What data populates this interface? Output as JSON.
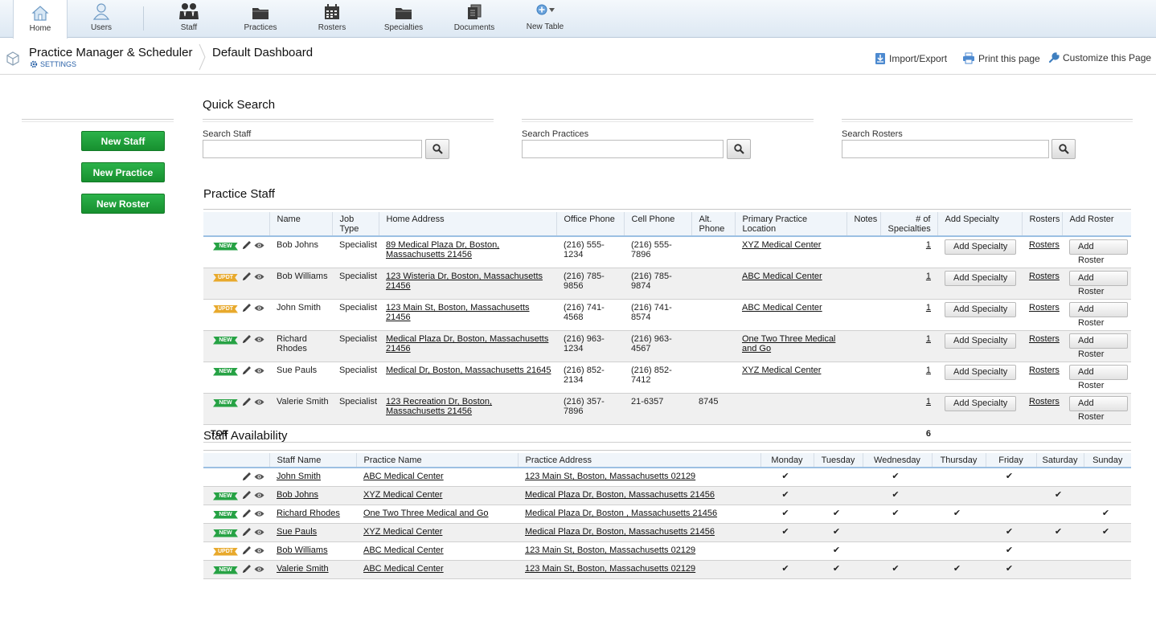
{
  "nav": {
    "items": [
      {
        "label": "Home",
        "icon": "home-icon"
      },
      {
        "label": "Users",
        "icon": "user-icon"
      },
      {
        "label": "Staff",
        "icon": "staff-icon"
      },
      {
        "label": "Practices",
        "icon": "folder-icon"
      },
      {
        "label": "Rosters",
        "icon": "calendar-icon"
      },
      {
        "label": "Specialties",
        "icon": "folder-icon"
      },
      {
        "label": "Documents",
        "icon": "documents-icon"
      },
      {
        "label": "New Table",
        "icon": "add-table-icon"
      }
    ]
  },
  "header": {
    "app_title": "Practice Manager & Scheduler",
    "settings_label": "SETTINGS",
    "page_title": "Default Dashboard",
    "import_export": "Import/Export",
    "print": "Print this page",
    "customize": "Customize this Page"
  },
  "sidebar": {
    "new_staff": "New Staff",
    "new_practice": "New Practice",
    "new_roster": "New Roster"
  },
  "quick_search": {
    "title": "Quick Search",
    "staff_label": "Search Staff",
    "practices_label": "Search Practices",
    "rosters_label": "Search Rosters"
  },
  "practice_staff": {
    "title": "Practice Staff",
    "columns": {
      "name": "Name",
      "job_type": "Job Type",
      "home_address": "Home Address",
      "office_phone": "Office Phone",
      "cell_phone": "Cell Phone",
      "alt_phone": "Alt. Phone",
      "primary_location": "Primary Practice Location",
      "notes": "Notes",
      "num_specialties": "# of Specialties",
      "add_specialty": "Add Specialty",
      "rosters": "Rosters",
      "add_roster": "Add Roster"
    },
    "rows": [
      {
        "tag": "NEW",
        "name": "Bob Johns",
        "job_type": "Specialist",
        "address": "89 Medical Plaza Dr, Boston, Massachusetts 21456",
        "office": "(216) 555-1234",
        "cell": "(216) 555-7896",
        "alt": "",
        "location": "XYZ Medical Center",
        "notes": "",
        "specialties": "1",
        "add_specialty": "Add Specialty",
        "rosters": "Rosters",
        "add_roster": "Add Roster"
      },
      {
        "tag": "UPDT",
        "name": "Bob Williams",
        "job_type": "Specialist",
        "address": "123 Wisteria Dr, Boston, Massachusetts 21456",
        "office": "(216) 785-9856",
        "cell": "(216) 785-9874",
        "alt": "",
        "location": "ABC Medical Center",
        "notes": "",
        "specialties": "1",
        "add_specialty": "Add Specialty",
        "rosters": "Rosters",
        "add_roster": "Add Roster"
      },
      {
        "tag": "UPDT",
        "name": "John Smith",
        "job_type": "Specialist",
        "address": "123 Main St, Boston, Massachusetts 21456",
        "office": "(216) 741-4568",
        "cell": "(216) 741-8574",
        "alt": "",
        "location": "ABC Medical Center",
        "notes": "",
        "specialties": "1",
        "add_specialty": "Add Specialty",
        "rosters": "Rosters",
        "add_roster": "Add Roster"
      },
      {
        "tag": "NEW",
        "name": "Richard Rhodes",
        "job_type": "Specialist",
        "address": "Medical Plaza Dr, Boston, Massachusetts 21456",
        "office": "(216) 963-1234",
        "cell": "(216) 963-4567",
        "alt": "",
        "location": "One Two Three Medical and Go",
        "notes": "",
        "specialties": "1",
        "add_specialty": "Add Specialty",
        "rosters": "Rosters",
        "add_roster": "Add Roster"
      },
      {
        "tag": "NEW",
        "name": "Sue Pauls",
        "job_type": "Specialist",
        "address": "Medical Dr, Boston, Massachusetts 21645",
        "office": "(216) 852-2134",
        "cell": "(216) 852-7412",
        "alt": "",
        "location": "XYZ Medical Center",
        "notes": "",
        "specialties": "1",
        "add_specialty": "Add Specialty",
        "rosters": "Rosters",
        "add_roster": "Add Roster"
      },
      {
        "tag": "NEW",
        "name": "Valerie Smith",
        "job_type": "Specialist",
        "address": "123 Recreation Dr, Boston, Massachusetts 21456",
        "office": "(216) 357-7896",
        "cell": "21-6357",
        "alt": "8745",
        "location": "",
        "notes": "",
        "specialties": "1",
        "add_specialty": "Add Specialty",
        "rosters": "Rosters",
        "add_roster": "Add Roster"
      }
    ],
    "total_label": "TOT",
    "total_value": "6"
  },
  "staff_availability": {
    "title": "Staff Availability",
    "columns": {
      "staff_name": "Staff Name",
      "practice_name": "Practice Name",
      "practice_address": "Practice Address",
      "days": [
        "Monday",
        "Tuesday",
        "Wednesday",
        "Thursday",
        "Friday",
        "Saturday",
        "Sunday"
      ]
    },
    "check_glyph": "✔",
    "rows": [
      {
        "tag": "",
        "staff": "John Smith",
        "practice": "ABC Medical Center",
        "address": "123 Main St, Boston, Massachusetts 02129",
        "days": [
          true,
          false,
          true,
          false,
          true,
          false,
          false
        ]
      },
      {
        "tag": "NEW",
        "staff": "Bob Johns",
        "practice": "XYZ Medical Center",
        "address": "Medical Plaza Dr, Boston, Massachusetts 21456",
        "days": [
          true,
          false,
          true,
          false,
          false,
          true,
          false
        ]
      },
      {
        "tag": "NEW",
        "staff": "Richard Rhodes",
        "practice": "One Two Three Medical and Go",
        "address": "Medical Plaza Dr, Boston , Massachusetts 21456",
        "days": [
          true,
          true,
          true,
          true,
          false,
          false,
          true
        ]
      },
      {
        "tag": "NEW",
        "staff": "Sue Pauls",
        "practice": "XYZ Medical Center",
        "address": "Medical Plaza Dr, Boston, Massachusetts 21456",
        "days": [
          true,
          true,
          false,
          false,
          true,
          true,
          true
        ]
      },
      {
        "tag": "UPDT",
        "staff": "Bob Williams",
        "practice": "ABC Medical Center",
        "address": "123 Main St, Boston, Massachusetts 02129",
        "days": [
          false,
          true,
          false,
          false,
          true,
          false,
          false
        ]
      },
      {
        "tag": "NEW",
        "staff": "Valerie Smith",
        "practice": "ABC Medical Center",
        "address": "123 Main St, Boston, Massachusetts 02129",
        "days": [
          true,
          true,
          true,
          true,
          true,
          false,
          false
        ]
      }
    ]
  }
}
